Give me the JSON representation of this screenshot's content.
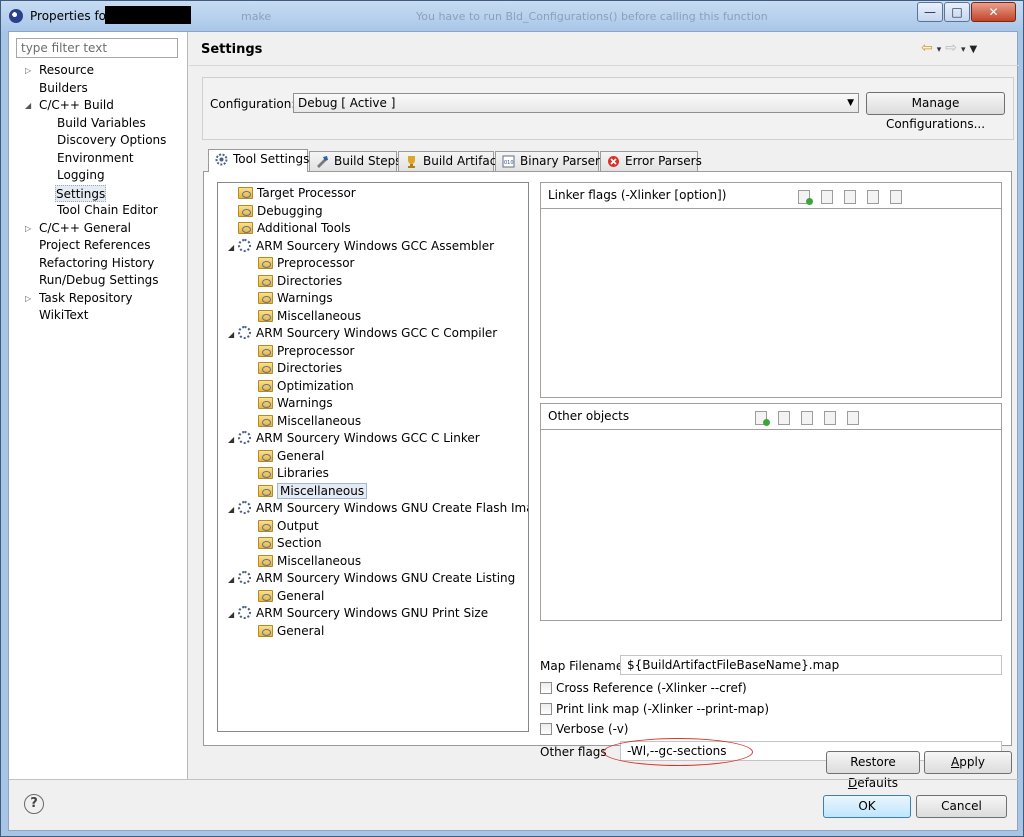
{
  "window": {
    "title": "Properties for",
    "ghost_text_1": "make",
    "ghost_text_2": "You have to run Bld_Configurations() before calling this function",
    "buttons": {
      "minimize": "—",
      "maximize": "□",
      "close": "✕"
    }
  },
  "sidebar": {
    "filter_placeholder": "type filter text",
    "items": [
      {
        "label": "Resource",
        "level": 0,
        "expander": "▷"
      },
      {
        "label": "Builders",
        "level": 0,
        "expander": ""
      },
      {
        "label": "C/C++ Build",
        "level": 0,
        "expander": "◢"
      },
      {
        "label": "Build Variables",
        "level": 1,
        "expander": ""
      },
      {
        "label": "Discovery Options",
        "level": 1,
        "expander": ""
      },
      {
        "label": "Environment",
        "level": 1,
        "expander": ""
      },
      {
        "label": "Logging",
        "level": 1,
        "expander": ""
      },
      {
        "label": "Settings",
        "level": 1,
        "expander": "",
        "selected": true
      },
      {
        "label": "Tool Chain Editor",
        "level": 1,
        "expander": ""
      },
      {
        "label": "C/C++ General",
        "level": 0,
        "expander": "▷"
      },
      {
        "label": "Project References",
        "level": 0,
        "expander": ""
      },
      {
        "label": "Refactoring History",
        "level": 0,
        "expander": ""
      },
      {
        "label": "Run/Debug Settings",
        "level": 0,
        "expander": ""
      },
      {
        "label": "Task Repository",
        "level": 0,
        "expander": "▷"
      },
      {
        "label": "WikiText",
        "level": 0,
        "expander": ""
      }
    ]
  },
  "header": {
    "title": "Settings",
    "nav": {
      "back": "⇦",
      "back_menu": "▾",
      "forward": "⇨",
      "forward_menu": "▾",
      "view_menu": "▼"
    }
  },
  "configuration": {
    "label": "Configuration:",
    "value": "Debug  [ Active ]",
    "dropdown_arrow": "▼",
    "manage_button": "Manage Configurations..."
  },
  "tabs": [
    {
      "label": "Tool Settings",
      "icon": "tool-settings-icon",
      "active": true
    },
    {
      "label": "Build Steps",
      "icon": "build-steps-icon"
    },
    {
      "label": "Build Artifact",
      "icon": "build-artifact-icon"
    },
    {
      "label": "Binary Parsers",
      "icon": "binary-parsers-icon"
    },
    {
      "label": "Error Parsers",
      "icon": "error-parsers-icon"
    }
  ],
  "tool_tree": [
    {
      "label": "Target Processor",
      "level": 0,
      "kind": "folder"
    },
    {
      "label": "Debugging",
      "level": 0,
      "kind": "folder"
    },
    {
      "label": "Additional Tools",
      "level": 0,
      "kind": "folder"
    },
    {
      "label": "ARM Sourcery Windows GCC Assembler",
      "level": 0,
      "kind": "tool",
      "expander": "◢"
    },
    {
      "label": "Preprocessor",
      "level": 1,
      "kind": "folder"
    },
    {
      "label": "Directories",
      "level": 1,
      "kind": "folder"
    },
    {
      "label": "Warnings",
      "level": 1,
      "kind": "folder"
    },
    {
      "label": "Miscellaneous",
      "level": 1,
      "kind": "folder"
    },
    {
      "label": "ARM Sourcery Windows GCC C Compiler",
      "level": 0,
      "kind": "tool",
      "expander": "◢"
    },
    {
      "label": "Preprocessor",
      "level": 1,
      "kind": "folder"
    },
    {
      "label": "Directories",
      "level": 1,
      "kind": "folder"
    },
    {
      "label": "Optimization",
      "level": 1,
      "kind": "folder"
    },
    {
      "label": "Warnings",
      "level": 1,
      "kind": "folder"
    },
    {
      "label": "Miscellaneous",
      "level": 1,
      "kind": "folder"
    },
    {
      "label": "ARM Sourcery Windows GCC C Linker",
      "level": 0,
      "kind": "tool",
      "expander": "◢"
    },
    {
      "label": "General",
      "level": 1,
      "kind": "folder"
    },
    {
      "label": "Libraries",
      "level": 1,
      "kind": "folder"
    },
    {
      "label": "Miscellaneous",
      "level": 1,
      "kind": "folder",
      "selected": true
    },
    {
      "label": "ARM Sourcery Windows GNU Create Flash Image",
      "level": 0,
      "kind": "tool",
      "expander": "◢"
    },
    {
      "label": "Output",
      "level": 1,
      "kind": "folder"
    },
    {
      "label": "Section",
      "level": 1,
      "kind": "folder"
    },
    {
      "label": "Miscellaneous",
      "level": 1,
      "kind": "folder"
    },
    {
      "label": "ARM Sourcery Windows GNU Create Listing",
      "level": 0,
      "kind": "tool",
      "expander": "◢"
    },
    {
      "label": "General",
      "level": 1,
      "kind": "folder"
    },
    {
      "label": "ARM Sourcery Windows GNU Print Size",
      "level": 0,
      "kind": "tool",
      "expander": "◢"
    },
    {
      "label": "General",
      "level": 1,
      "kind": "folder"
    }
  ],
  "linker_flags": {
    "title": "Linker flags (-Xlinker [option])",
    "items": []
  },
  "other_objects": {
    "title": "Other objects",
    "items": []
  },
  "list_tools": [
    "add-icon",
    "delete-icon",
    "edit-icon",
    "move-up-icon",
    "move-down-icon"
  ],
  "map_filename": {
    "label": "Map Filename",
    "value": "${BuildArtifactFileBaseName}.map"
  },
  "checkboxes": [
    {
      "label": "Cross Reference (-Xlinker --cref)",
      "checked": false
    },
    {
      "label": "Print link map (-Xlinker --print-map)",
      "checked": false
    },
    {
      "label": "Verbose (-v)",
      "checked": false
    }
  ],
  "other_flags": {
    "label": "Other flags",
    "value": "-Wl,--gc-sections"
  },
  "buttons": {
    "restore_defaults_pre": "Restore ",
    "restore_defaults_u": "D",
    "restore_defaults_post": "efaults",
    "apply_pre": "",
    "apply_u": "A",
    "apply_post": "pply",
    "ok": "OK",
    "cancel": "Cancel"
  },
  "help_symbol": "?",
  "colors": {
    "annotation": "#d8322b",
    "selection": "#e5ebf3"
  }
}
